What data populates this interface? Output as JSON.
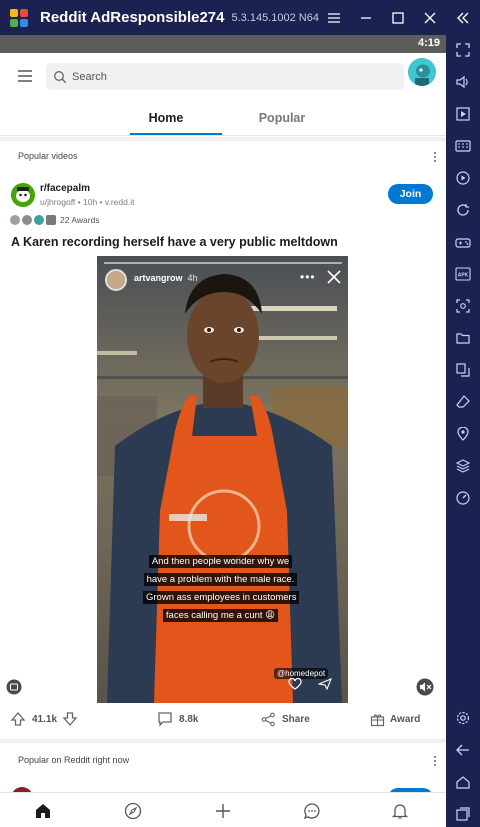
{
  "emulator": {
    "app_title": "Reddit AdResponsible274",
    "version": "5.3.145.1002 N64"
  },
  "status_bar": {
    "time": "4:19"
  },
  "search": {
    "placeholder": "Search"
  },
  "tabs": [
    {
      "label": "Home",
      "active": true
    },
    {
      "label": "Popular",
      "active": false
    }
  ],
  "section_popular_videos": {
    "label": "Popular videos"
  },
  "post": {
    "subreddit": "r/facepalm",
    "meta": "u/jhrogoff • 10h • v.redd.it",
    "join_label": "Join",
    "awards_text": "22 Awards",
    "title": "A Karen recording herself have a very public meltdown",
    "video": {
      "story_user": "artvangrow",
      "story_age": "4h",
      "story_more": "•••",
      "caption": "And then people wonder why we have a problem with the male race. Grown ass employees in customers faces calling me a cunt 😩",
      "sticker_tag": "@homedepot"
    },
    "upvotes": "41.1k",
    "comments": "8.8k",
    "share_label": "Share",
    "award_label": "Award"
  },
  "section_popular_now": {
    "label": "Popular on Reddit right now"
  },
  "colors": {
    "emulator_bg": "#1b2150",
    "reddit_blue": "#0079d3",
    "status_bar": "#5c5c5c",
    "apron_orange": "#e2561c"
  },
  "icons": {
    "emulator_side": [
      "fullscreen-icon",
      "volume-icon",
      "screen-record-icon",
      "keyboard-icon",
      "play-macro-icon",
      "rotate-icon",
      "gamepad-icon",
      "apk-install-icon",
      "screenshot-icon",
      "folder-icon",
      "multi-instance-icon",
      "eraser-icon",
      "location-icon",
      "layers-icon",
      "speed-icon",
      "settings-icon",
      "back-icon",
      "home-icon",
      "recents-icon"
    ],
    "bottom_nav": [
      "home-icon",
      "discover-icon",
      "create-icon",
      "chat-icon",
      "notifications-icon"
    ]
  }
}
